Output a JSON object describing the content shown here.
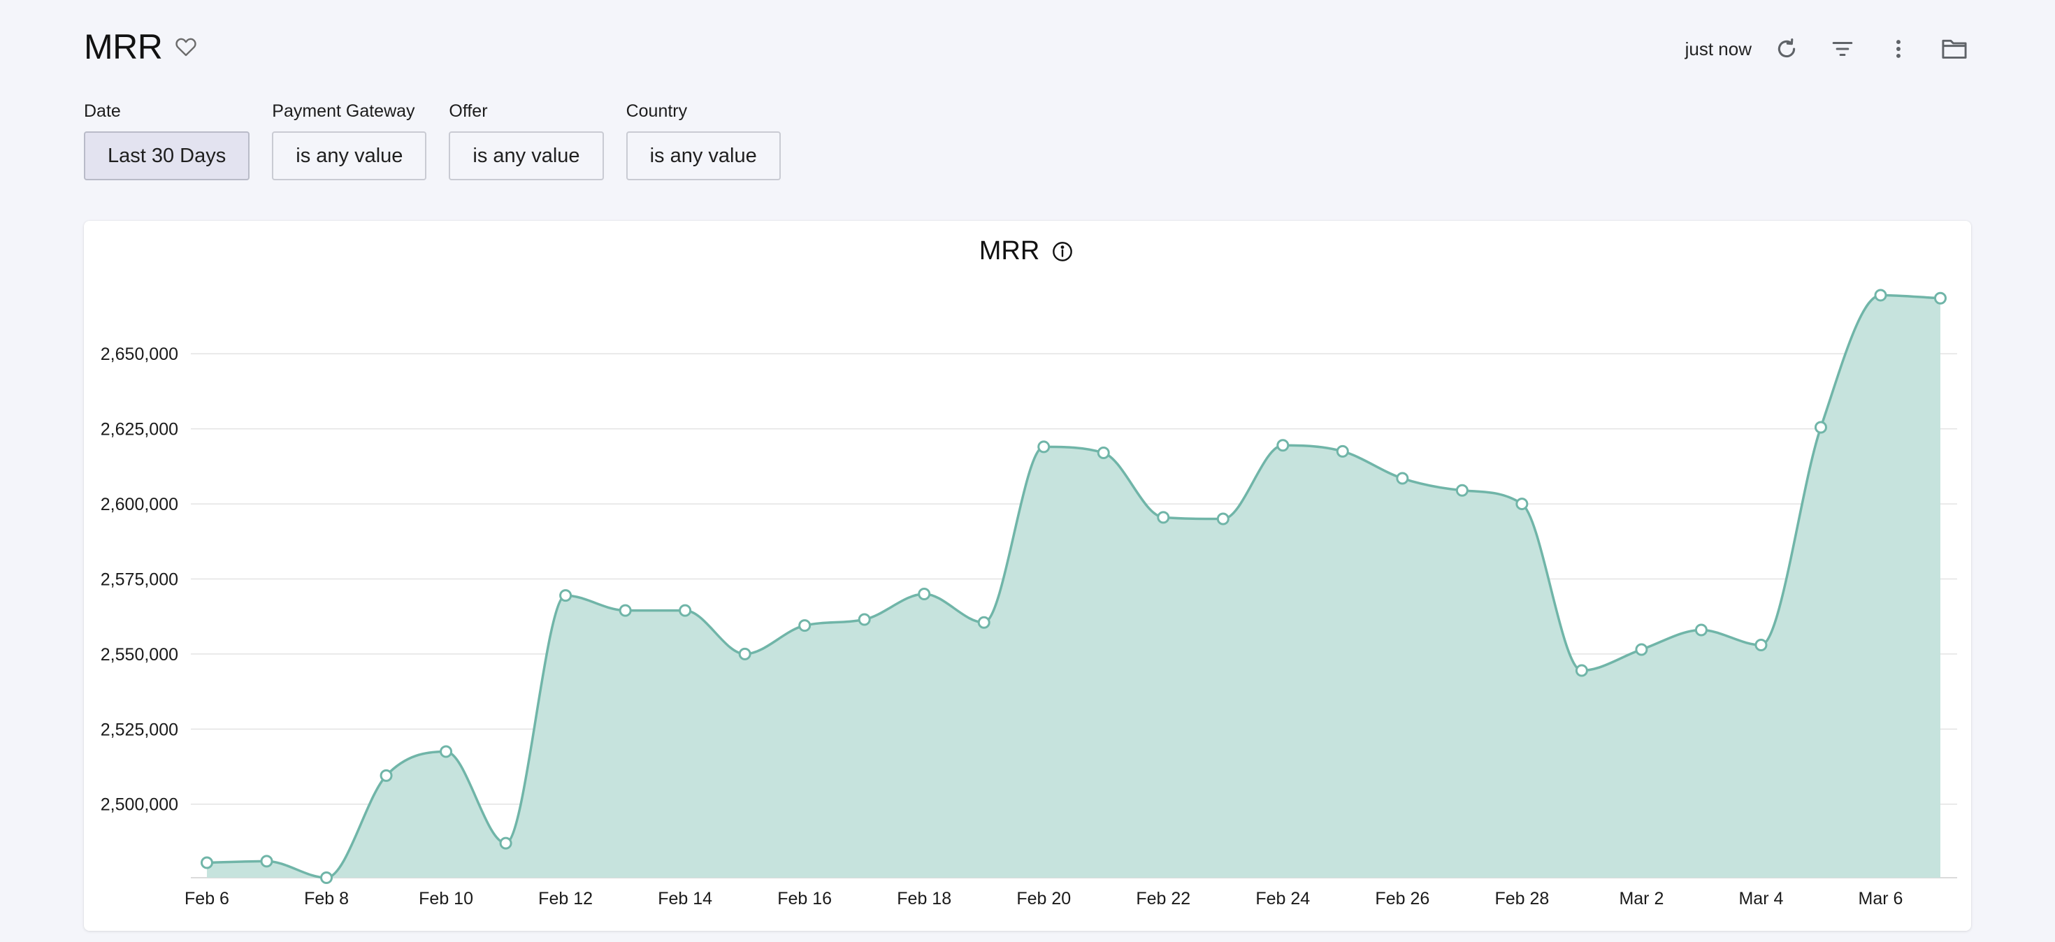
{
  "header": {
    "title": "MRR",
    "updated": "just now",
    "icons": {
      "favorite": "heart-icon",
      "refresh": "refresh-icon",
      "filter": "filter-icon",
      "more": "more-vertical-icon",
      "folder": "folder-icon"
    }
  },
  "filters": [
    {
      "label": "Date",
      "value": "Last 30 Days",
      "active": true
    },
    {
      "label": "Payment Gateway",
      "value": "is any value",
      "active": false
    },
    {
      "label": "Offer",
      "value": "is any value",
      "active": false
    },
    {
      "label": "Country",
      "value": "is any value",
      "active": false
    }
  ],
  "colors": {
    "line": "#70b5a8",
    "fill": "#c6e3dd",
    "grid": "#e3e3e3",
    "background": "#f4f5fa"
  },
  "chart_data": {
    "type": "area",
    "title": "MRR",
    "xlabel": "",
    "ylabel": "",
    "x": [
      "Feb 6",
      "Feb 7",
      "Feb 8",
      "Feb 9",
      "Feb 10",
      "Feb 11",
      "Feb 12",
      "Feb 13",
      "Feb 14",
      "Feb 15",
      "Feb 16",
      "Feb 17",
      "Feb 18",
      "Feb 19",
      "Feb 20",
      "Feb 21",
      "Feb 22",
      "Feb 23",
      "Feb 24",
      "Feb 25",
      "Feb 26",
      "Feb 27",
      "Feb 28",
      "Mar 1",
      "Mar 2",
      "Mar 3",
      "Mar 4",
      "Mar 5",
      "Mar 6",
      "Mar 7"
    ],
    "x_tick_labels": [
      "Feb 6",
      "Feb 8",
      "Feb 10",
      "Feb 12",
      "Feb 14",
      "Feb 16",
      "Feb 18",
      "Feb 20",
      "Feb 22",
      "Feb 24",
      "Feb 26",
      "Feb 28",
      "Mar 2",
      "Mar 4",
      "Mar 6"
    ],
    "series": [
      {
        "values": [
          2480500,
          2481000,
          2475500,
          2509500,
          2517500,
          2487000,
          2569500,
          2564500,
          2564500,
          2550000,
          2559500,
          2561500,
          2570000,
          2560500,
          2619000,
          2617000,
          2595500,
          2595000,
          2619500,
          2617500,
          2608500,
          2604500,
          2600000,
          2544500,
          2551500,
          2558000,
          2553000,
          2625500,
          2669500,
          2668500
        ]
      }
    ],
    "y_ticks": [
      2500000,
      2525000,
      2550000,
      2575000,
      2600000,
      2625000,
      2650000
    ],
    "y_tick_labels": [
      "2,500,000",
      "2,525,000",
      "2,550,000",
      "2,575,000",
      "2,600,000",
      "2,625,000",
      "2,650,000"
    ],
    "ylim": [
      2475500,
      2671000
    ],
    "grid": true,
    "legend": "none",
    "markers": "hollow-circle",
    "curve": "smooth"
  }
}
